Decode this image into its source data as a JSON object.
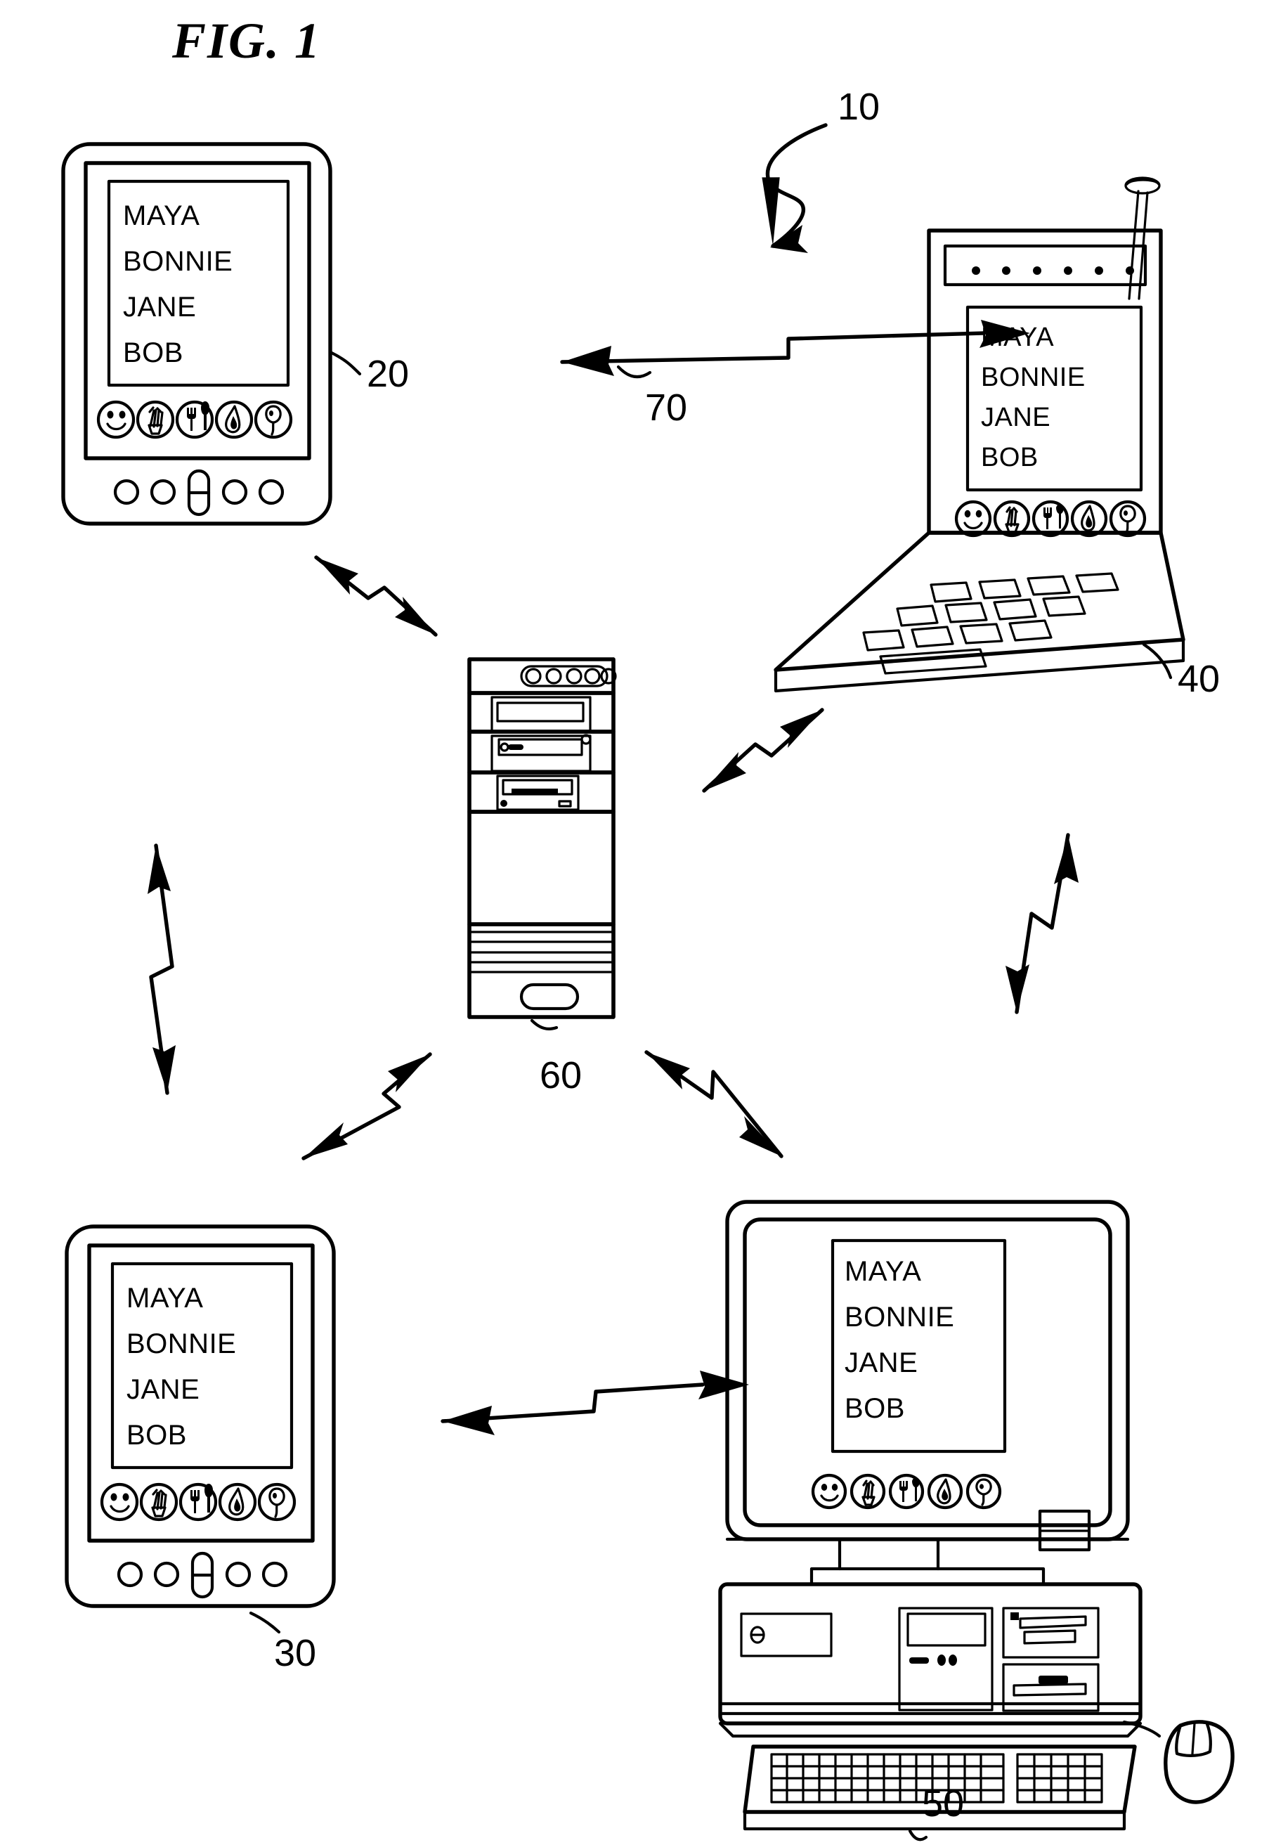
{
  "figure": {
    "title": "FIG.  1",
    "type": "patent-drawing",
    "background_color": "#ffffff",
    "line_color": "#000000"
  },
  "contact_list": {
    "names": [
      "MAYA",
      "BONNIE",
      "JANE",
      "BOB"
    ]
  },
  "icon_row": {
    "icons": [
      {
        "name": "smiley-face-icon",
        "label": "smiley"
      },
      {
        "name": "plant-bundle-icon",
        "label": "plant"
      },
      {
        "name": "fork-spoon-icon",
        "label": "utensils"
      },
      {
        "name": "flame-icon",
        "label": "flame"
      },
      {
        "name": "balloon-icon",
        "label": "balloon"
      }
    ]
  },
  "devices": [
    {
      "id": "pda-top-left",
      "ref": "20",
      "kind": "handheld-pda",
      "names": [
        "MAYA",
        "BONNIE",
        "JANE",
        "BOB"
      ],
      "button_count": 5
    },
    {
      "id": "communicator-top-right",
      "ref": "40",
      "kind": "flip-communicator",
      "names": [
        "MAYA",
        "BONNIE",
        "JANE",
        "BOB"
      ],
      "has_antenna": true,
      "speaker_dots": 6
    },
    {
      "id": "server-tower-center",
      "ref": "60",
      "kind": "tower-server",
      "led_count": 5
    },
    {
      "id": "pda-bottom-left",
      "ref": "30",
      "kind": "handheld-pda",
      "names": [
        "MAYA",
        "BONNIE",
        "JANE",
        "BOB"
      ],
      "button_count": 5
    },
    {
      "id": "desktop-bottom-right",
      "ref": "50",
      "kind": "desktop-computer",
      "names": [
        "MAYA",
        "BONNIE",
        "JANE",
        "BOB"
      ],
      "has_mouse": true,
      "has_keyboard": true
    }
  ],
  "reference_numerals": {
    "system": "10",
    "pda_top_left": "20",
    "pda_bottom_left": "30",
    "communicator": "40",
    "desktop": "50",
    "server": "60",
    "network_link": "70"
  },
  "links": [
    {
      "name": "link-pda20-to-communicator40",
      "label": "70",
      "style": "bidirectional-lightning"
    },
    {
      "name": "link-pda20-to-server60",
      "label": "",
      "style": "bidirectional-lightning"
    },
    {
      "name": "link-server60-to-communicator40",
      "label": "",
      "style": "bidirectional-lightning"
    },
    {
      "name": "link-pda20-to-pda30",
      "label": "",
      "style": "bidirectional-lightning"
    },
    {
      "name": "link-communicator40-to-desktop50",
      "label": "",
      "style": "bidirectional-lightning"
    },
    {
      "name": "link-server60-to-pda30",
      "label": "",
      "style": "bidirectional-lightning"
    },
    {
      "name": "link-server60-to-desktop50",
      "label": "",
      "style": "bidirectional-lightning"
    },
    {
      "name": "link-pda30-to-desktop50",
      "label": "",
      "style": "bidirectional-lightning"
    }
  ],
  "system_callout": {
    "label": "10",
    "style": "curved-arrow"
  }
}
